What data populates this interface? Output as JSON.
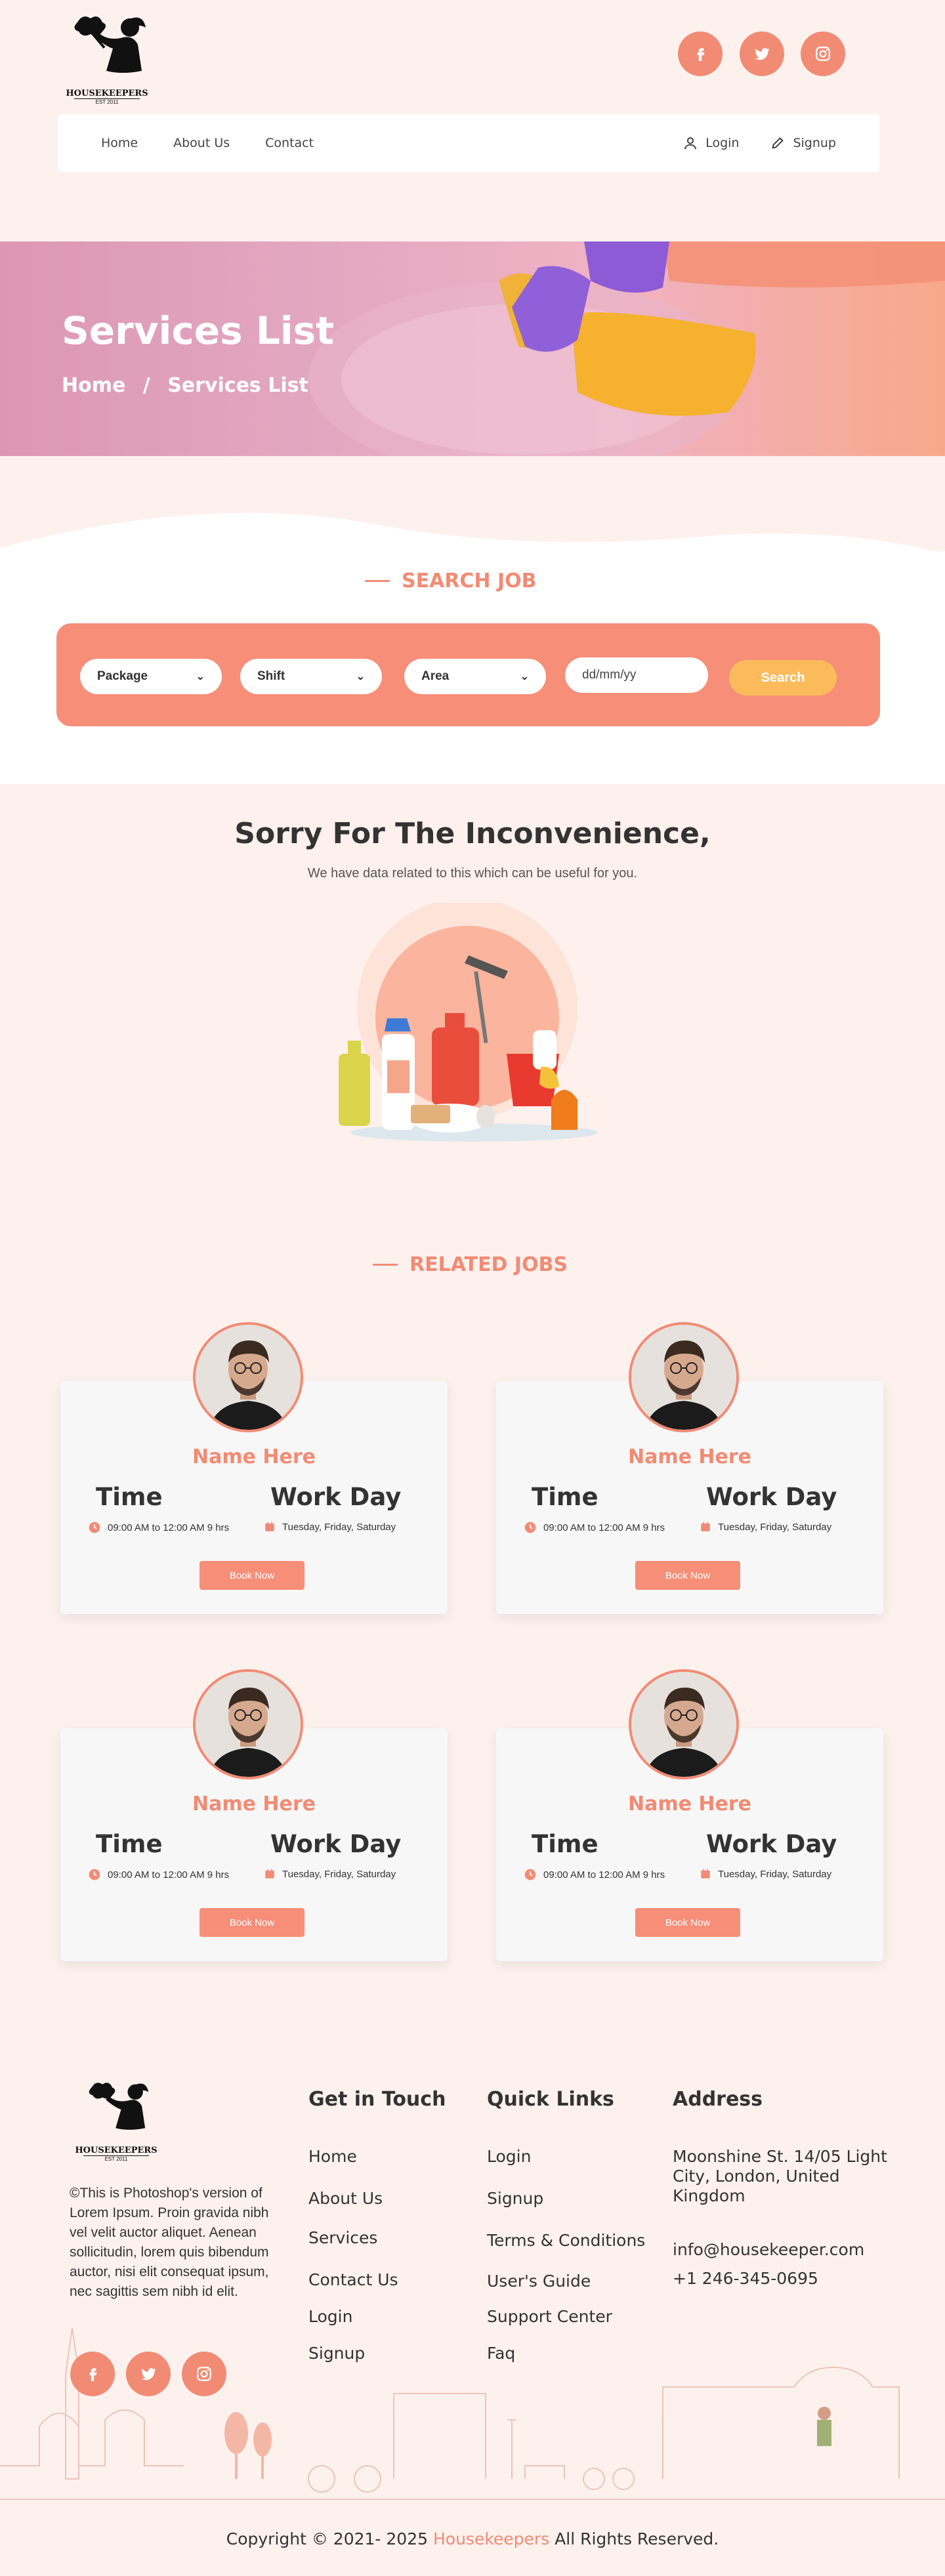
{
  "header": {
    "brand_name": "HOUSEKEEPERS",
    "brand_tagline": "EST 2011",
    "social": [
      {
        "icon": "facebook-icon"
      },
      {
        "icon": "twitter-icon"
      },
      {
        "icon": "instagram-icon"
      }
    ],
    "nav": {
      "items": [
        "Home",
        "About Us",
        "Contact"
      ],
      "login": "Login",
      "signup": "Signup"
    }
  },
  "banner": {
    "title": "Services List",
    "crumb_home": "Home",
    "crumb_sep": "/",
    "crumb_current": "Services List"
  },
  "search": {
    "heading": "SEARCH JOB",
    "package": "Package",
    "shift": "Shift",
    "area": "Area",
    "date_placeholder": "dd/mm/yy",
    "button": "Search"
  },
  "sorry": {
    "title": "Sorry For The Inconvenience,",
    "subtitle": "We have data related to this which can be useful for you."
  },
  "related": {
    "heading": "RELATED JOBS",
    "time_label": "Time",
    "workday_label": "Work Day",
    "jobs": [
      {
        "name": "Name Here",
        "time": "09:00 AM to 12:00 AM 9 hrs",
        "days": "Tuesday, Friday, Saturday",
        "button": "Book Now"
      },
      {
        "name": "Name Here",
        "time": "09:00 AM to 12:00 AM 9 hrs",
        "days": "Tuesday, Friday, Saturday",
        "button": "Book Now"
      },
      {
        "name": "Name Here",
        "time": "09:00 AM to 12:00 AM 9 hrs",
        "days": "Tuesday, Friday, Saturday",
        "button": "Book Now"
      },
      {
        "name": "Name Here",
        "time": "09:00 AM to 12:00 AM 9 hrs",
        "days": "Tuesday, Friday, Saturday",
        "button": "Book Now"
      }
    ]
  },
  "footer": {
    "about": "©This is Photoshop's version of Lorem Ipsum. Proin gravida nibh vel velit auctor aliquet. Aenean sollicitudin, lorem quis bibendum auctor, nisi elit consequat ipsum, nec sagittis sem nibh id elit.",
    "get_in_touch": {
      "title": "Get in Touch",
      "links": [
        "Home",
        "About Us",
        "Services",
        "Contact Us",
        "Login",
        "Signup"
      ]
    },
    "quick_links": {
      "title": "Quick Links",
      "links": [
        "Login",
        "Signup",
        "Terms & Conditions",
        "User's Guide",
        "Support Center",
        "Faq"
      ]
    },
    "address": {
      "title": "Address",
      "line": "Moonshine St. 14/05 Light City, London, United Kingdom",
      "email": "info@housekeeper.com",
      "phone": "+1 246-345-0695"
    },
    "copyright_pre": "Copyright © 2021- 2025",
    "copyright_brand": "Housekeepers",
    "copyright_post": "All Rights Reserved."
  },
  "colors": {
    "accent": "#f28b74",
    "search_button": "#fcbb5b",
    "background": "#fdf1ee"
  }
}
